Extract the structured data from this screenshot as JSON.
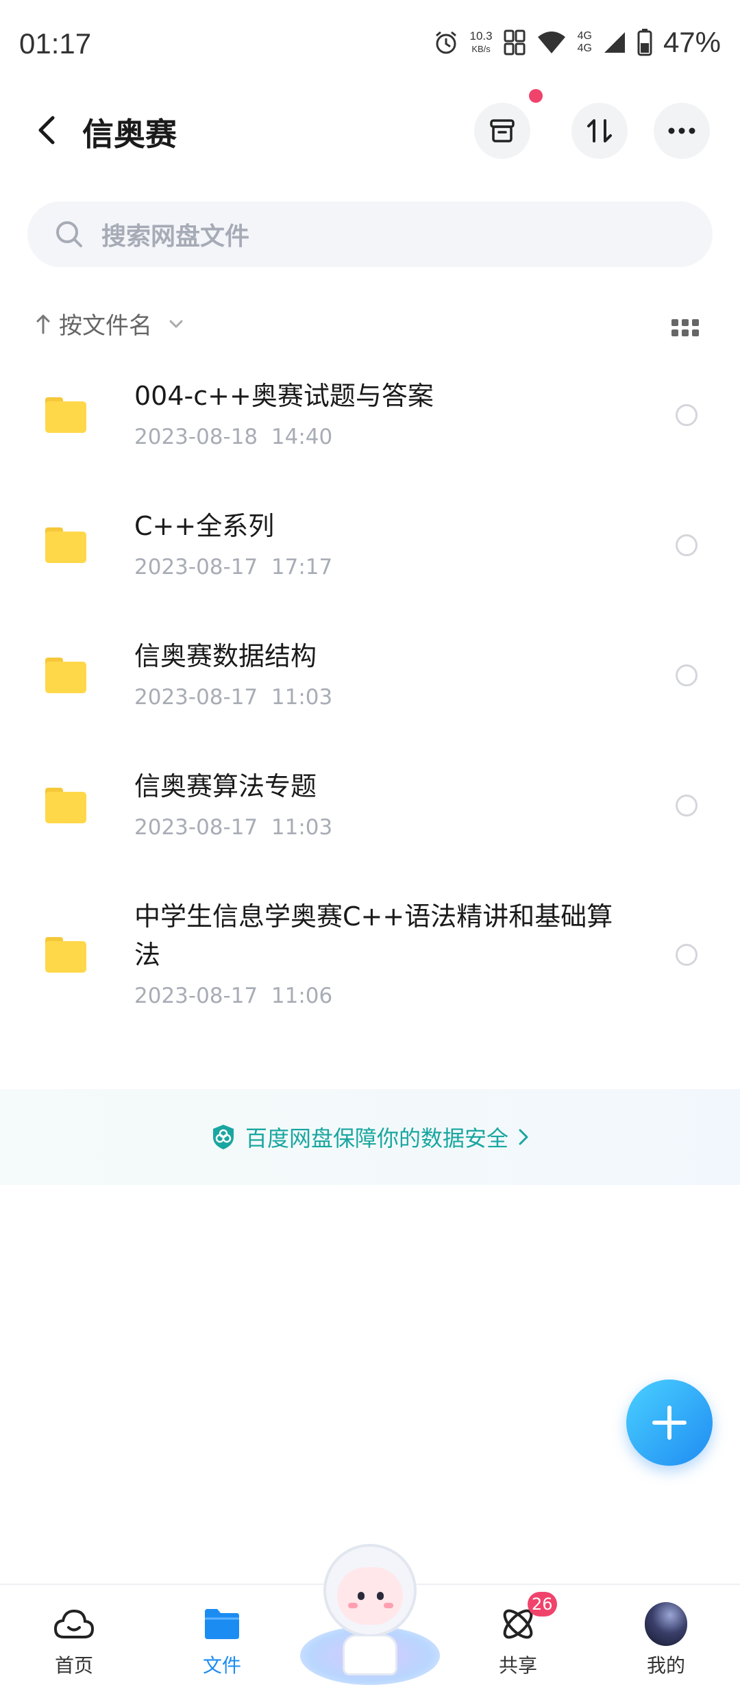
{
  "status_bar": {
    "time": "01:17",
    "net_speed": "10.3",
    "net_unit": "KB/s",
    "signal_top": "4G",
    "signal_bottom": "4G",
    "battery": "47%",
    "icons": [
      "alarm-icon",
      "hd-icon",
      "wifi-icon",
      "signal-icon",
      "battery-icon"
    ]
  },
  "header": {
    "title": "信奥赛",
    "buttons": [
      "back-icon",
      "archive-icon",
      "transfer-icon",
      "more-icon"
    ]
  },
  "search": {
    "placeholder": "搜索网盘文件"
  },
  "sort": {
    "label": "按文件名"
  },
  "files": [
    {
      "name": "004-c++奥赛试题与答案",
      "date": "2023-08-18",
      "time": "14:40"
    },
    {
      "name": "C++全系列",
      "date": "2023-08-17",
      "time": "17:17"
    },
    {
      "name": "信奥赛数据结构",
      "date": "2023-08-17",
      "time": "11:03"
    },
    {
      "name": "信奥赛算法专题",
      "date": "2023-08-17",
      "time": "11:03"
    },
    {
      "name": "中学生信息学奥赛C++语法精讲和基础算法",
      "date": "2023-08-17",
      "time": "11:06"
    }
  ],
  "security_banner": {
    "text": "百度网盘保障你的数据安全"
  },
  "bottom_nav": {
    "home": "首页",
    "files": "文件",
    "share": "共享",
    "share_badge": "26",
    "mine": "我的"
  },
  "colors": {
    "accent": "#1b8cf2",
    "badge": "#f0436b",
    "folder": "#ffd84a",
    "security": "#1aa6a0"
  }
}
